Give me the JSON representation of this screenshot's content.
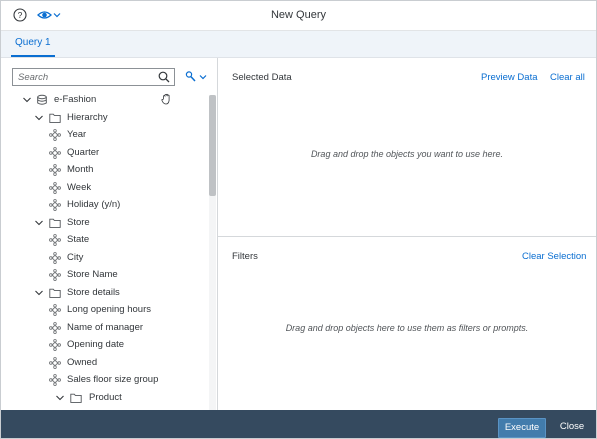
{
  "window": {
    "title": "New Query"
  },
  "tabs": [
    {
      "label": "Query 1"
    }
  ],
  "search": {
    "placeholder": "Search",
    "value": ""
  },
  "tree": {
    "root": "e-Fashion",
    "items": [
      {
        "type": "folder",
        "label": "Hierarchy"
      },
      {
        "type": "object",
        "label": "Year"
      },
      {
        "type": "object",
        "label": "Quarter"
      },
      {
        "type": "object",
        "label": "Month"
      },
      {
        "type": "object",
        "label": "Week"
      },
      {
        "type": "object",
        "label": "Holiday (y/n)"
      },
      {
        "type": "folder",
        "label": "Store"
      },
      {
        "type": "object",
        "label": "State"
      },
      {
        "type": "object",
        "label": "City"
      },
      {
        "type": "object",
        "label": "Store Name"
      },
      {
        "type": "folder",
        "label": "Store details"
      },
      {
        "type": "object",
        "label": "Long opening hours"
      },
      {
        "type": "object",
        "label": "Name of manager"
      },
      {
        "type": "object",
        "label": "Opening date"
      },
      {
        "type": "object",
        "label": "Owned"
      },
      {
        "type": "object",
        "label": "Sales floor size group"
      },
      {
        "type": "subfolder",
        "label": "Product"
      }
    ]
  },
  "selected_data": {
    "title": "Selected Data",
    "preview_label": "Preview Data",
    "clear_label": "Clear all",
    "hint": "Drag and drop the objects you want to use here."
  },
  "filters": {
    "title": "Filters",
    "clear_label": "Clear Selection",
    "hint": "Drag and drop objects here to use them as filters or prompts."
  },
  "footer": {
    "execute_label": "Execute",
    "close_label": "Close"
  },
  "colors": {
    "accent": "#0a6ed1",
    "footer_bg": "#354a5f",
    "execute_bg": "#427cac",
    "tab_bar_bg": "#eff4f9"
  }
}
